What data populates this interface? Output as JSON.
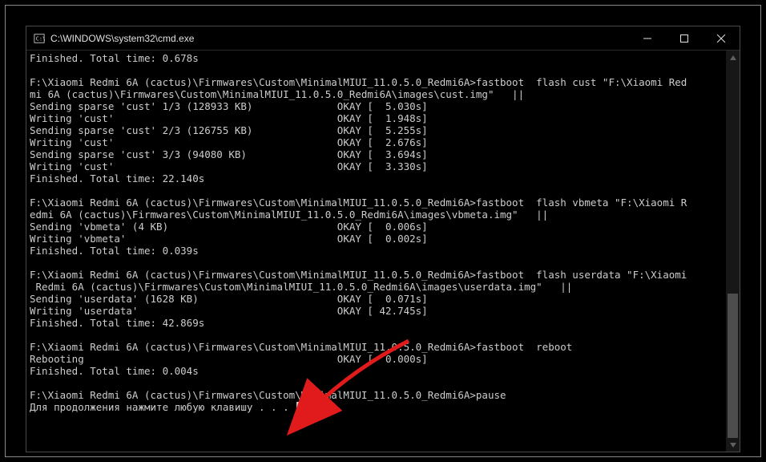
{
  "titlebar": {
    "title": "C:\\WINDOWS\\system32\\cmd.exe"
  },
  "terminal": {
    "lines": [
      "Finished. Total time: 0.678s",
      "",
      "F:\\Xiaomi Redmi 6A (cactus)\\Firmwares\\Custom\\MinimalMIUI_11.0.5.0_Redmi6A>fastboot  flash cust \"F:\\Xiaomi Red",
      "mi 6A (cactus)\\Firmwares\\Custom\\MinimalMIUI_11.0.5.0_Redmi6A\\images\\cust.img\"   ||",
      "Sending sparse 'cust' 1/3 (128933 KB)              OKAY [  5.030s]",
      "Writing 'cust'                                     OKAY [  1.948s]",
      "Sending sparse 'cust' 2/3 (126755 KB)              OKAY [  5.255s]",
      "Writing 'cust'                                     OKAY [  2.676s]",
      "Sending sparse 'cust' 3/3 (94080 KB)               OKAY [  3.694s]",
      "Writing 'cust'                                     OKAY [  3.330s]",
      "Finished. Total time: 22.140s",
      "",
      "F:\\Xiaomi Redmi 6A (cactus)\\Firmwares\\Custom\\MinimalMIUI_11.0.5.0_Redmi6A>fastboot  flash vbmeta \"F:\\Xiaomi R",
      "edmi 6A (cactus)\\Firmwares\\Custom\\MinimalMIUI_11.0.5.0_Redmi6A\\images\\vbmeta.img\"   ||",
      "Sending 'vbmeta' (4 KB)                            OKAY [  0.006s]",
      "Writing 'vbmeta'                                   OKAY [  0.002s]",
      "Finished. Total time: 0.039s",
      "",
      "F:\\Xiaomi Redmi 6A (cactus)\\Firmwares\\Custom\\MinimalMIUI_11.0.5.0_Redmi6A>fastboot  flash userdata \"F:\\Xiaomi",
      " Redmi 6A (cactus)\\Firmwares\\Custom\\MinimalMIUI_11.0.5.0_Redmi6A\\images\\userdata.img\"   ||",
      "Sending 'userdata' (1628 KB)                       OKAY [  0.071s]",
      "Writing 'userdata'                                 OKAY [ 42.745s]",
      "Finished. Total time: 42.869s",
      "",
      "F:\\Xiaomi Redmi 6A (cactus)\\Firmwares\\Custom\\MinimalMIUI_11.0.5.0_Redmi6A>fastboot  reboot",
      "Rebooting                                          OKAY [  0.000s]",
      "Finished. Total time: 0.004s",
      "",
      "F:\\Xiaomi Redmi 6A (cactus)\\Firmwares\\Custom\\MinimalMIUI_11.0.5.0_Redmi6A>pause",
      "Для продолжения нажмите любую клавишу . . . "
    ]
  },
  "annotation": {
    "arrow_color": "#e11b1b"
  }
}
